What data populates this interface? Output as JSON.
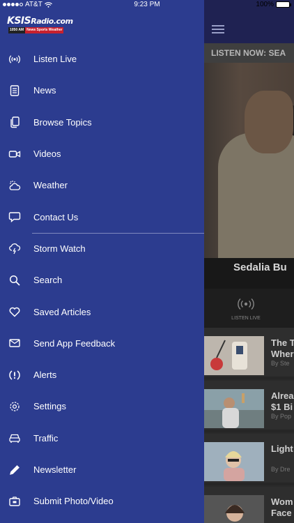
{
  "status": {
    "carrier": "AT&T",
    "time": "9:23 PM",
    "battery": "100%"
  },
  "app": {
    "logo_main": "KSIS",
    "logo_suffix": "Radio.com",
    "logo_freq": "1050 AM",
    "logo_tag": "News Sports Weather"
  },
  "menu": [
    {
      "label": "Listen Live",
      "icon": "broadcast-icon"
    },
    {
      "label": "News",
      "icon": "document-icon"
    },
    {
      "label": "Browse Topics",
      "icon": "copy-icon"
    },
    {
      "label": "Videos",
      "icon": "video-camera-icon"
    },
    {
      "label": "Weather",
      "icon": "partly-cloudy-icon"
    },
    {
      "label": "Contact Us",
      "icon": "chat-bubble-icon"
    },
    {
      "label": "Storm Watch",
      "icon": "storm-cloud-icon"
    },
    {
      "label": "Search",
      "icon": "search-icon"
    },
    {
      "label": "Saved Articles",
      "icon": "heart-icon"
    },
    {
      "label": "Send App Feedback",
      "icon": "envelope-icon"
    },
    {
      "label": "Alerts",
      "icon": "alert-icon"
    },
    {
      "label": "Settings",
      "icon": "gear-icon"
    },
    {
      "label": "Traffic",
      "icon": "car-icon"
    },
    {
      "label": "Newsletter",
      "icon": "pencil-icon"
    },
    {
      "label": "Submit Photo/Video",
      "icon": "camera-icon"
    }
  ],
  "content": {
    "listen_strip": "LISTEN NOW: SEA",
    "hero_caption": "Sedalia Bu",
    "tab_listen": "LISTEN LIVE",
    "articles": [
      {
        "title1": "The T",
        "title2": "Wher",
        "by": "By Ste"
      },
      {
        "title1": "Alrea",
        "title2": "$1 Bi",
        "by": "By Pop"
      },
      {
        "title1": "Light",
        "title2": "",
        "by": "By Dre"
      },
      {
        "title1": "Wom",
        "title2": "Face",
        "by": ""
      }
    ]
  },
  "colors": {
    "drawer_bg": "#2c3c8f",
    "logo_red": "#c8202e"
  }
}
